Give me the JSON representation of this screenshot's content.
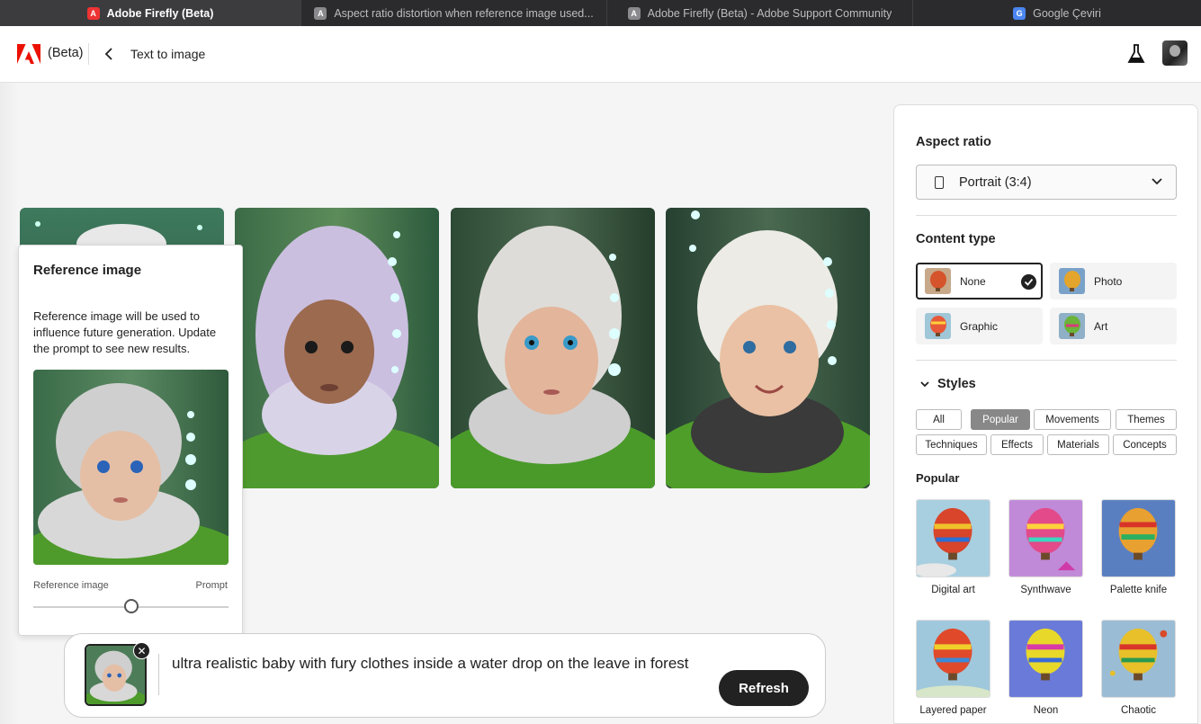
{
  "browser": {
    "tabs": [
      {
        "title": "Adobe Firefly (Beta)",
        "icon": "adobe-icon",
        "active": true
      },
      {
        "title": "Aspect ratio distortion when reference image used...",
        "icon": "community-icon",
        "active": false
      },
      {
        "title": "Adobe Firefly (Beta) - Adobe Support Community",
        "icon": "community-icon",
        "active": false
      },
      {
        "title": "Google Çeviri",
        "icon": "google-translate-icon",
        "active": false
      }
    ]
  },
  "header": {
    "beta_label": "(Beta)",
    "breadcrumb": "Text to image"
  },
  "reference_popover": {
    "title": "Reference image",
    "description": "Reference image will be used to influence future generation. Update the prompt to see new results.",
    "slider_left_label": "Reference image",
    "slider_right_label": "Prompt",
    "slider_value": 0.5
  },
  "prompt": {
    "text": "ultra realistic baby with fury clothes inside a water drop on the leave in forest",
    "refresh_label": "Refresh"
  },
  "panel": {
    "aspect_ratio_title": "Aspect ratio",
    "aspect_ratio_value": "Portrait (3:4)",
    "content_type_title": "Content type",
    "content_types": [
      {
        "label": "None",
        "selected": true
      },
      {
        "label": "Photo",
        "selected": false
      },
      {
        "label": "Graphic",
        "selected": false
      },
      {
        "label": "Art",
        "selected": false
      }
    ],
    "styles_title": "Styles",
    "style_filters": [
      "All",
      "Popular",
      "Movements",
      "Themes",
      "Techniques",
      "Effects",
      "Materials",
      "Concepts"
    ],
    "active_filter": "Popular",
    "popular_title": "Popular",
    "styles": [
      "Digital art",
      "Synthwave",
      "Palette knife",
      "Layered paper",
      "Neon",
      "Chaotic"
    ]
  },
  "colors": {
    "accent_dark": "#222222",
    "tabbar": "#2b2b2d",
    "adobe_red": "#eb1000"
  }
}
